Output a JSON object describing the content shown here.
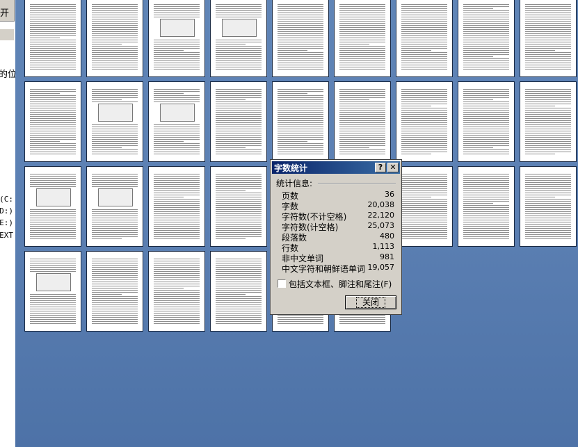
{
  "left_pane": {
    "open_label": "开",
    "position_text": "的位",
    "drive_c": "(C:",
    "drive_d": "D:)",
    "drive_e": "E:)",
    "ext_text": "EXT"
  },
  "preview": {
    "background_color": "#5c80b3"
  },
  "dialog": {
    "title": "字数统计",
    "help_label": "?",
    "close_icon_label": "✕",
    "section_label": "统计信息:",
    "stats": [
      {
        "label": "页数",
        "value": "36"
      },
      {
        "label": "字数",
        "value": "20,038"
      },
      {
        "label": "字符数(不计空格)",
        "value": "22,120"
      },
      {
        "label": "字符数(计空格)",
        "value": "25,073"
      },
      {
        "label": "段落数",
        "value": "480"
      },
      {
        "label": "行数",
        "value": "1,113"
      },
      {
        "label": "非中文单词",
        "value": "981"
      },
      {
        "label": "中文字符和朝鲜语单词",
        "value": "19,057"
      }
    ],
    "checkbox_label": "包括文本框、脚注和尾注(F)",
    "checkbox_checked": false,
    "close_button_label": "关闭"
  }
}
